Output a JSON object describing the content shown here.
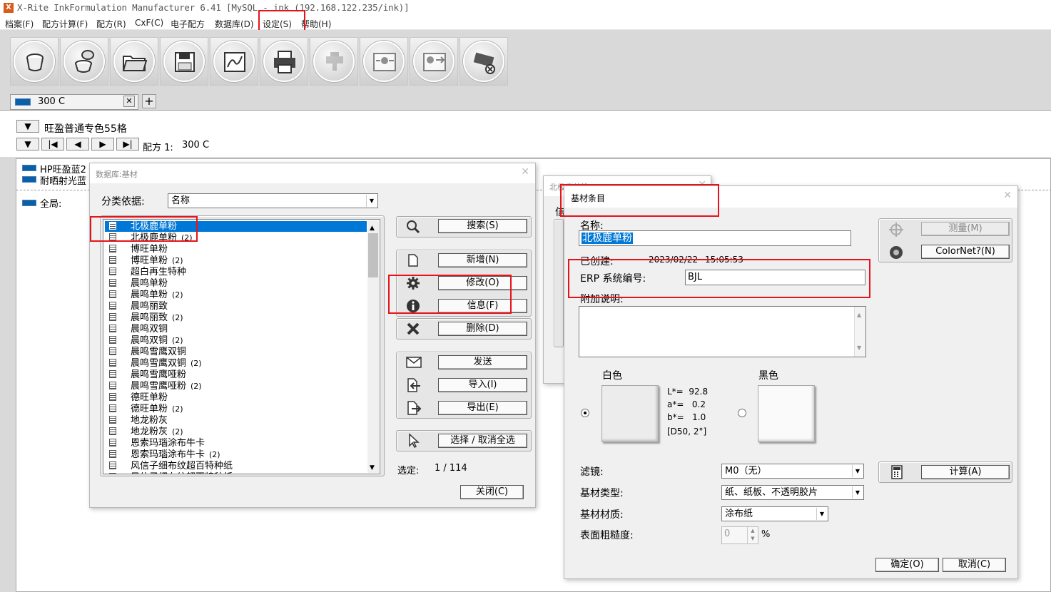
{
  "app": {
    "title": "X-Rite InkFormulation Manufacturer 6.41   [MySQL - ink (192.168.122.235/ink)]",
    "icon": "X"
  },
  "menu": [
    "档案(F)",
    "配方计算(F)",
    "配方(R)",
    "CxF(C)",
    "电子配方",
    "数据库(D)",
    "设定(S)",
    "帮助(H)"
  ],
  "toolbar_icons": [
    "ink-cup-icon",
    "ink-pour-icon",
    "folder-open-icon",
    "save-icon",
    "chart-curve-icon",
    "printer-icon",
    "dispenser-icon",
    "export-device-icon",
    "import-device-icon",
    "measure-off-icon"
  ],
  "tab": {
    "label": "300 C",
    "close": "✕",
    "add": "+",
    "swatch_color": "#0b5fa7"
  },
  "header": {
    "collection": "旺盈普通专色55格",
    "recipe_label": "配方 1:",
    "recipe_value": "300 C",
    "nav_buttons": [
      "▼",
      "|◀",
      "◀",
      "▶",
      "▶|"
    ]
  },
  "left_list": [
    "HP旺盈蓝2",
    "耐晒射光蓝",
    "全局:"
  ],
  "db_dialog": {
    "title": "数据库:基材",
    "group_label": "分类依据:",
    "group_value": "名称",
    "items": [
      {
        "name": "北极鹿单粉",
        "count": ""
      },
      {
        "name": "北极鹿单粉",
        "count": "(2)"
      },
      {
        "name": "博旺单粉",
        "count": ""
      },
      {
        "name": "博旺单粉",
        "count": "(2)"
      },
      {
        "name": "超白再生特种",
        "count": ""
      },
      {
        "name": "晨鸣单粉",
        "count": ""
      },
      {
        "name": "晨鸣单粉",
        "count": "(2)"
      },
      {
        "name": "晨鸣丽致",
        "count": ""
      },
      {
        "name": "晨鸣丽致",
        "count": "(2)"
      },
      {
        "name": "晨鸣双铜",
        "count": ""
      },
      {
        "name": "晨鸣双铜",
        "count": "(2)"
      },
      {
        "name": "晨鸣雪鹰双铜",
        "count": ""
      },
      {
        "name": "晨鸣雪鹰双铜",
        "count": "(2)"
      },
      {
        "name": "晨鸣雪鹰哑粉",
        "count": ""
      },
      {
        "name": "晨鸣雪鹰哑粉",
        "count": "(2)"
      },
      {
        "name": "德旺单粉",
        "count": ""
      },
      {
        "name": "德旺单粉",
        "count": "(2)"
      },
      {
        "name": "地龙粉灰",
        "count": ""
      },
      {
        "name": "地龙粉灰",
        "count": "(2)"
      },
      {
        "name": "恩索玛瑙涂布牛卡",
        "count": ""
      },
      {
        "name": "恩索玛瑙涂布牛卡",
        "count": "(2)"
      },
      {
        "name": "风信子细布纹超百特种纸",
        "count": ""
      },
      {
        "name": "风信子细布纹超百特种纸",
        "count": ""
      }
    ],
    "buttons": {
      "search": "搜索(S)",
      "add": "新增(N)",
      "modify": "修改(O)",
      "info": "信息(F)",
      "delete": "删除(D)",
      "send": "发送",
      "import": "导入(I)",
      "export": "导出(E)",
      "select_all": "选择 / 取消全选"
    },
    "selected_label": "选定:",
    "selected_value": "1 / 114",
    "close": "关闭(C)"
  },
  "bg_dialog": {
    "title": "北极鹿单粉",
    "label": "信"
  },
  "entry_dialog": {
    "title": "基材条目",
    "name_label": "名称:",
    "name_value": "北极鹿单粉",
    "created_label": "已创建:",
    "created_date": "2023/02/22",
    "created_time": "15:05:53",
    "erp_label": "ERP 系统编号:",
    "erp_value": "BJL",
    "notes_label": "附加说明:",
    "notes_value": "",
    "measure": "测量(M)",
    "colornet": "ColorNet?(N)",
    "white_label": "白色",
    "black_label": "黑色",
    "lab": {
      "L": "L*=",
      "L_val": "92.8",
      "a": "a*=",
      "a_val": "0.2",
      "b": "b*=",
      "b_val": "1.0",
      "illum": "[D50, 2°]"
    },
    "filter_label": "滤镜:",
    "filter_value": "M0（无）",
    "type_label": "基材类型:",
    "type_value": "纸、纸板、不透明胶片",
    "material_label": "基材材质:",
    "material_value": "涂布纸",
    "roughness_label": "表面粗糙度:",
    "roughness_value": "0",
    "roughness_unit": "%",
    "calc": "计算(A)",
    "ok": "确定(O)",
    "cancel": "取消(C)"
  },
  "colors": {
    "highlight": "#0078d7",
    "annotation_red": "#e8131a",
    "swatch_blue": "#0b5fa7"
  }
}
